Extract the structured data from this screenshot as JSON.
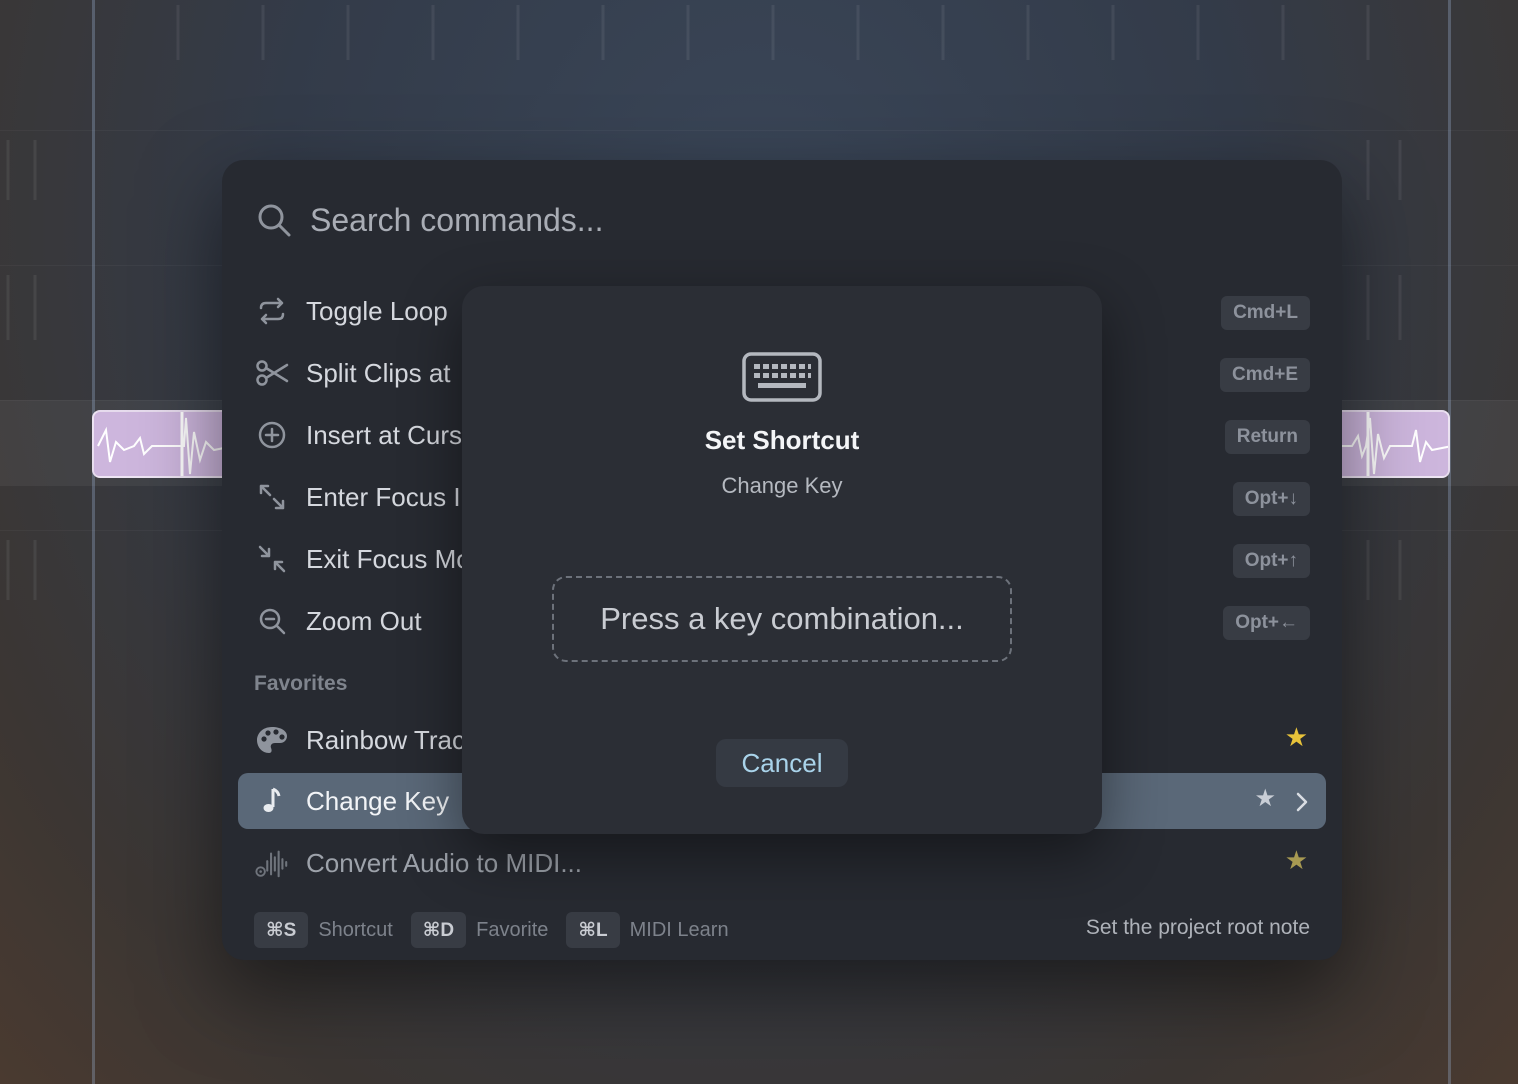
{
  "search": {
    "placeholder": "Search commands..."
  },
  "commands": [
    {
      "label": "Toggle Loop",
      "icon": "loop-icon",
      "shortcut": "Cmd+L"
    },
    {
      "label": "Split Clips at",
      "icon": "scissors-icon",
      "shortcut": "Cmd+E"
    },
    {
      "label": "Insert at Curs",
      "icon": "plus-circle-icon",
      "shortcut": "Return"
    },
    {
      "label": "Enter Focus I",
      "icon": "expand-icon",
      "shortcut": "Opt+↓"
    },
    {
      "label": "Exit Focus Mo",
      "icon": "collapse-icon",
      "shortcut": "Opt+↑"
    },
    {
      "label": "Zoom Out",
      "icon": "zoom-out-icon",
      "shortcut": "Opt+←"
    }
  ],
  "favorites_header": "Favorites",
  "favorites": [
    {
      "label": "Rainbow Trac",
      "icon": "palette-icon"
    },
    {
      "label": "Change Key",
      "icon": "music-note-icon"
    },
    {
      "label": "Convert Audio to MIDI...",
      "icon": "audio-to-midi-icon"
    }
  ],
  "footer": {
    "items": [
      {
        "key": "⌘S",
        "label": "Shortcut"
      },
      {
        "key": "⌘D",
        "label": "Favorite"
      },
      {
        "key": "⌘L",
        "label": "MIDI Learn"
      }
    ],
    "hint": "Set the project root note"
  },
  "modal": {
    "icon": "keyboard-icon",
    "title": "Set Shortcut",
    "subtitle": "Change Key",
    "capture_text": "Press a key combination...",
    "cancel_label": "Cancel"
  },
  "colors": {
    "star": "#e8c33a",
    "selected_row": "#5a6878",
    "accent_text": "#a9d3ea"
  }
}
